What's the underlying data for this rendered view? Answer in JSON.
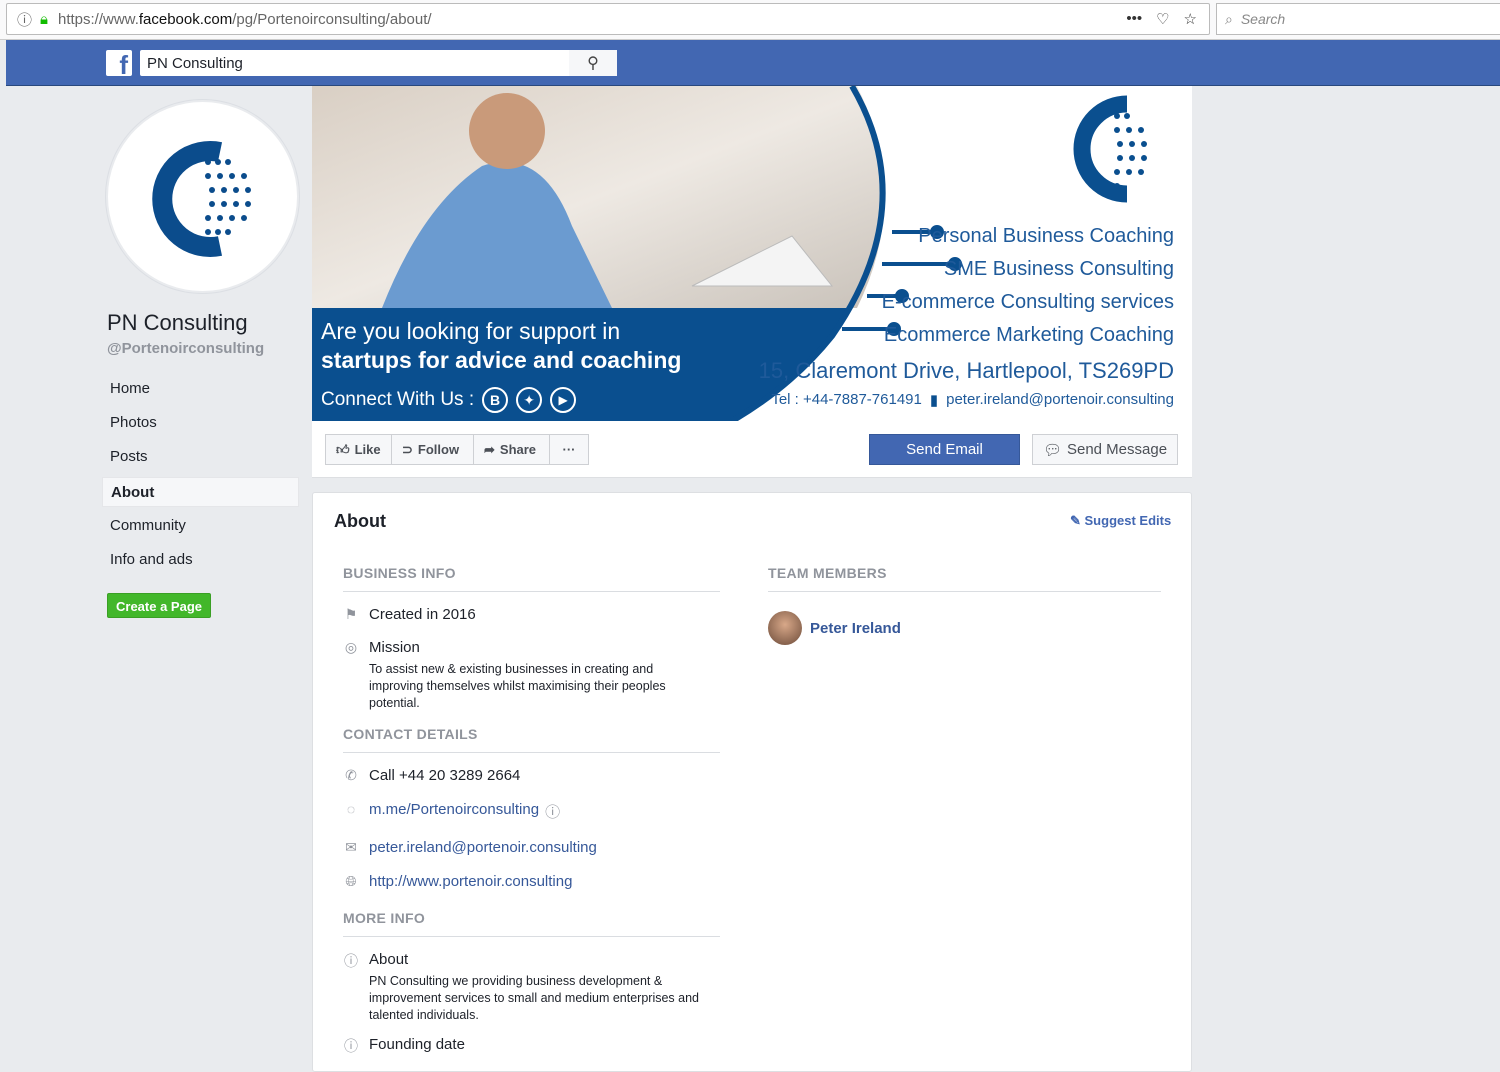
{
  "browser": {
    "url_prefix": "https://www.",
    "url_host": "facebook.com",
    "url_path": "/pg/Portenoirconsulting/about/",
    "search_placeholder": "Search"
  },
  "fb": {
    "search_value": "PN Consulting"
  },
  "page": {
    "name": "PN Consulting",
    "handle": "@Portenoirconsulting"
  },
  "nav": [
    "Home",
    "Photos",
    "Posts",
    "About",
    "Community",
    "Info and ads"
  ],
  "create_page": "Create a Page",
  "cover": {
    "headline1": "Are you looking for support in",
    "headline2": "startups for advice and coaching",
    "connect": "Connect With Us :",
    "services": [
      "Personal Business Coaching",
      "SME Business Consulting",
      "E-commerce Consulting services",
      "Ecommerce Marketing Coaching"
    ],
    "address": "15, Claremont Drive, Hartlepool, TS269PD",
    "tel": "Tel : +44-7887-761491",
    "email": "peter.ireland@portenoir.consulting",
    "brand_color": "#0a4f8f"
  },
  "actions": {
    "like": "Like",
    "follow": "Follow",
    "share": "Share",
    "more": "···",
    "send_email": "Send Email",
    "send_message": "Send Message"
  },
  "about": {
    "title": "About",
    "suggest": "Suggest Edits",
    "business_info": "BUSINESS INFO",
    "created": "Created in 2016",
    "mission_label": "Mission",
    "mission": "To assist new & existing businesses in creating and improving themselves whilst maximising their peoples potential.",
    "contact_details": "CONTACT DETAILS",
    "phone": "Call +44 20 3289 2664",
    "messenger": "m.me/Portenoirconsulting",
    "email": "peter.ireland@portenoir.consulting",
    "website": "http://www.portenoir.consulting",
    "more_info": "MORE INFO",
    "about_label": "About",
    "about_text": "PN Consulting we providing business development & improvement services to small and medium enterprises and talented individuals.",
    "founding": "Founding date",
    "team_members": "TEAM MEMBERS",
    "member": "Peter Ireland"
  }
}
